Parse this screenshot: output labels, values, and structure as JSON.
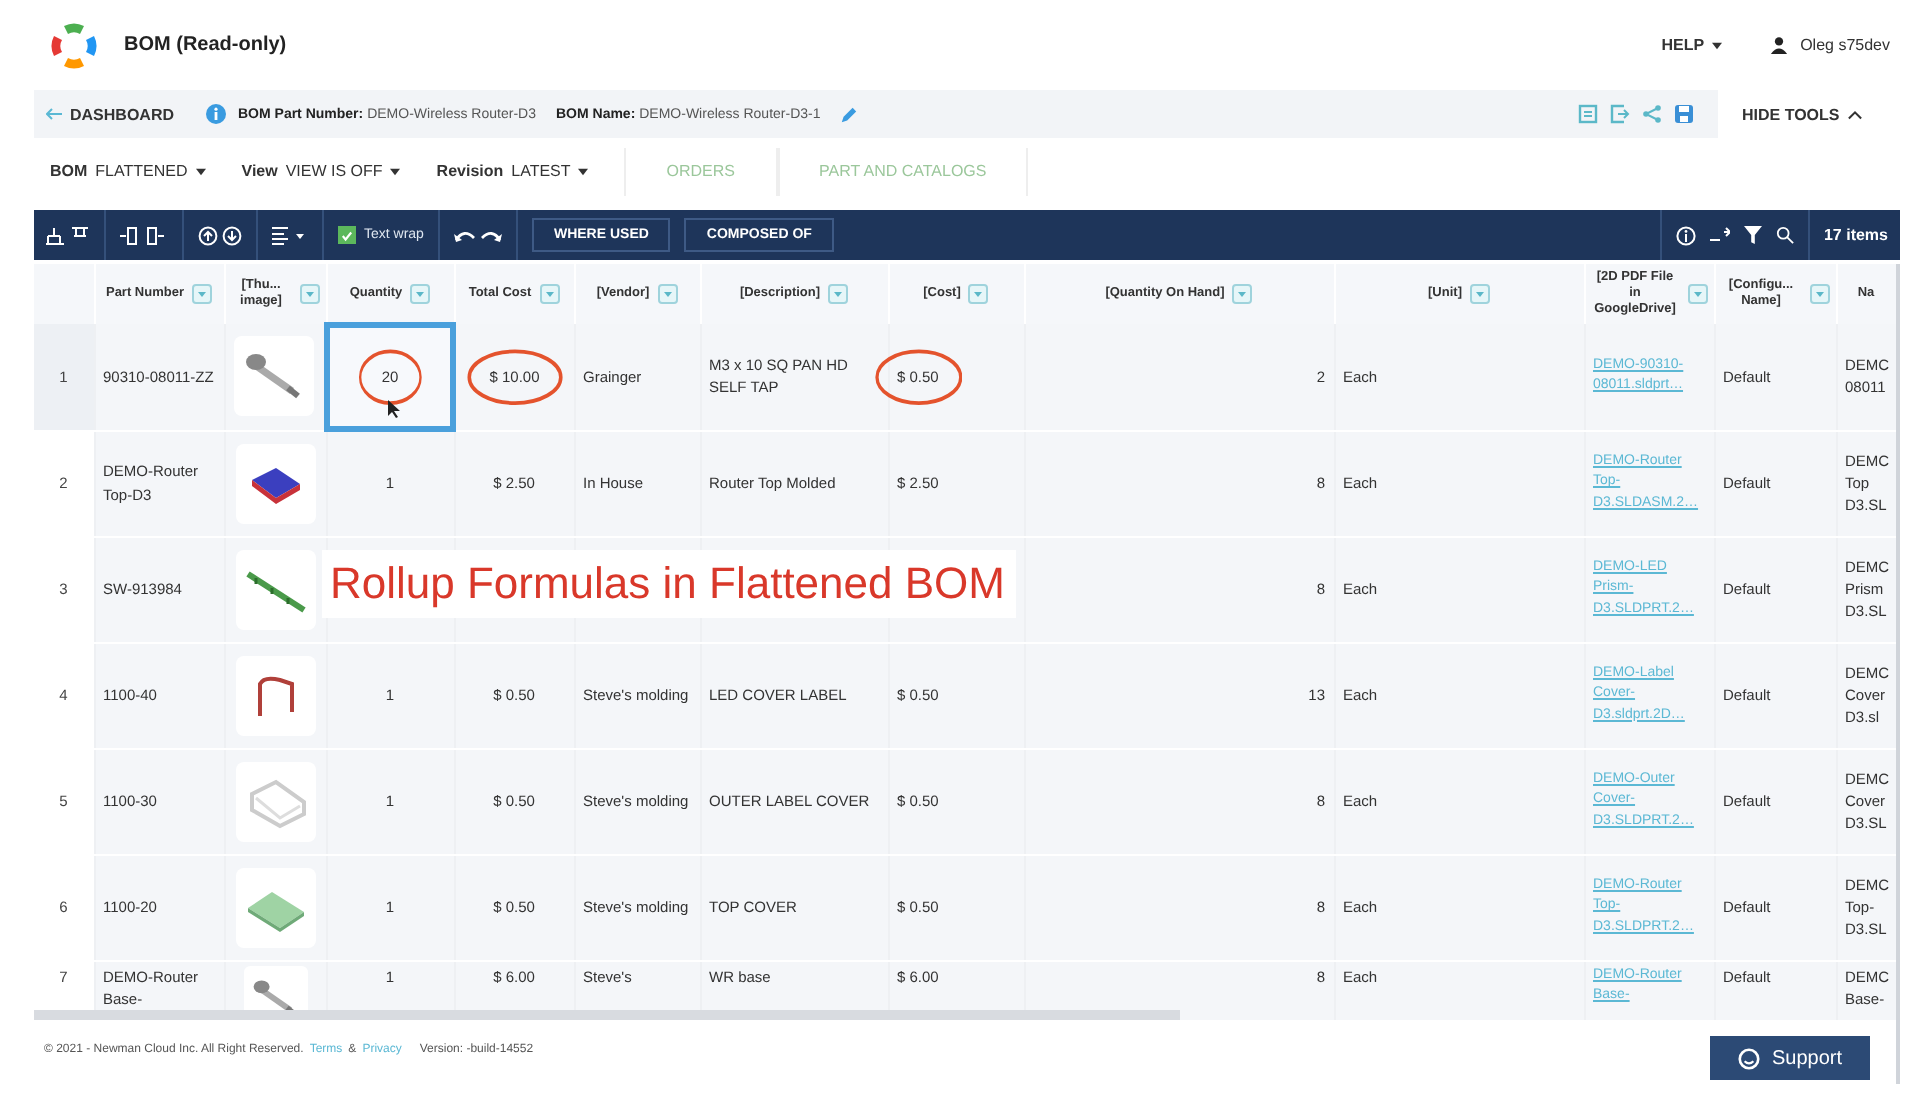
{
  "app": {
    "title": "BOM (Read-only)",
    "help": "HELP",
    "user": "Oleg s75dev"
  },
  "breadcrumb": {
    "back": "DASHBOARD",
    "part_number": "**BOM Part Number:** DEMO-Wireless Router-D3",
    "name": "**BOM Name:** DEMO-Wireless Router-D3-1",
    "hide_tools": "HIDE TOOLS"
  },
  "filters": [
    {
      "label": "BOM",
      "value": "FLATTENED"
    },
    {
      "label": "View",
      "value": "VIEW IS OFF"
    },
    {
      "label": "Revision",
      "value": "LATEST"
    }
  ],
  "tabs": [
    {
      "label": "ORDERS",
      "selected": false
    },
    {
      "label": "PART AND CATALOGS",
      "selected": false
    }
  ],
  "toolbar": {
    "text_wrap": {
      "label": "Text wrap",
      "checked": true
    },
    "buttons": [
      "WHERE USED",
      "COMPOSED OF"
    ],
    "count": "17 items"
  },
  "table": {
    "columns": [
      {
        "label": "Part Number",
        "filter": true,
        "kind": "text"
      },
      {
        "label": "[Thu... image]",
        "filter": true,
        "kind": "picture"
      },
      {
        "label": "Quantity",
        "filter": true,
        "kind": "center"
      },
      {
        "label": "Total Cost",
        "filter": true,
        "kind": "center"
      },
      {
        "label": "[Vendor]",
        "filter": true,
        "kind": "text"
      },
      {
        "label": "[Description]",
        "filter": true,
        "kind": "text"
      },
      {
        "label": "[Cost]",
        "filter": true,
        "kind": "text"
      },
      {
        "label": "[Quantity On Hand]",
        "filter": true,
        "kind": "number"
      },
      {
        "label": "[Unit]",
        "filter": true,
        "kind": "text"
      },
      {
        "label": "[2D PDF File in GoogleDrive]",
        "filter": true,
        "kind": "link"
      },
      {
        "label": "[Configu... Name]",
        "filter": true,
        "kind": "text"
      },
      {
        "label": "Na",
        "filter": false,
        "kind": "text"
      }
    ],
    "rows": [
      {
        "number": "1",
        "selected": true,
        "cells": [
          "90310-08011-ZZ",
          {
            "kind": "picture"
          },
          {
            "text": "20",
            "circled": true,
            "focused": true
          },
          {
            "text": "$ 10.00",
            "circled": true,
            "focused": false
          },
          "Grainger",
          "M3 x 10 SQ PAN HD SELF TAP",
          {
            "text": "$ 0.50",
            "circled": true,
            "focused": false
          },
          "2",
          "Each",
          "DEMO-90310-08011.sldprt…",
          "Default",
          "DEMC 08011"
        ]
      },
      {
        "number": "2",
        "selected": false,
        "cells": [
          "DEMO-Router Top-D3",
          {
            "kind": "picture"
          },
          "1",
          "$ 2.50",
          "In House",
          "Router Top Molded",
          "$ 2.50",
          "8",
          "Each",
          "DEMO-Router Top-D3.SLDASM.2…",
          "Default",
          "DEMC Top D3.SL"
        ]
      },
      {
        "number": "3",
        "selected": false,
        "cells": [
          "SW-913984",
          {
            "kind": "picture"
          },
          null,
          null,
          null,
          null,
          null,
          "8",
          "Each",
          "DEMO-LED Prism-D3.SLDPRT.2…",
          "Default",
          "DEMC Prism D3.SL"
        ]
      },
      {
        "number": "4",
        "selected": false,
        "cells": [
          "1100-40",
          {
            "kind": "picture"
          },
          "1",
          "$ 0.50",
          "Steve's molding",
          "LED COVER LABEL",
          "$ 0.50",
          "13",
          "Each",
          "DEMO-Label Cover-D3.sldprt.2D…",
          "Default",
          "DEMC Cover D3.sl"
        ]
      },
      {
        "number": "5",
        "selected": false,
        "cells": [
          "1100-30",
          {
            "kind": "picture"
          },
          "1",
          "$ 0.50",
          "Steve's molding",
          "OUTER LABEL COVER",
          "$ 0.50",
          "8",
          "Each",
          "DEMO-Outer Cover-D3.SLDPRT.2…",
          "Default",
          "DEMC Cover D3.SL"
        ]
      },
      {
        "number": "6",
        "selected": false,
        "cells": [
          "1100-20",
          {
            "kind": "picture"
          },
          "1",
          "$ 0.50",
          "Steve's molding",
          "TOP COVER",
          "$ 0.50",
          "8",
          "Each",
          "DEMO-Router Top-D3.SLDPRT.2…",
          "Default",
          "DEMC Top- D3.SL"
        ]
      },
      {
        "number": "7",
        "selected": false,
        "cells": [
          "DEMO-Router Base-",
          {
            "kind": "picture"
          },
          "1",
          "$ 6.00",
          "Steve's",
          "WR base",
          "$ 6.00",
          "8",
          "Each",
          "DEMO-Router Base-",
          "Default",
          "DEMC Base-"
        ]
      }
    ]
  },
  "annotation": {
    "caption": "Rollup Formulas in Flattened BOM"
  },
  "footer": {
    "copyright": "© 2021 - Newman Cloud Inc. All Right Reserved.",
    "terms": "Terms",
    "amp": "&",
    "privacy": "Privacy",
    "version": "Version: -build-14552",
    "support": "Support"
  }
}
